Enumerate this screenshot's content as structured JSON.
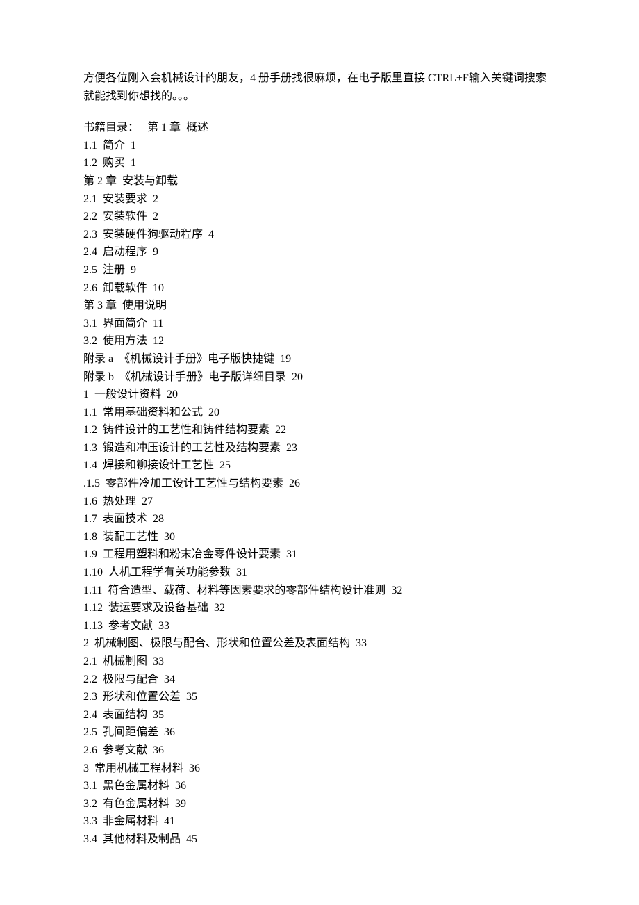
{
  "intro": "方便各位刚入会机械设计的朋友，4 册手册找很麻烦，在电子版里直接 CTRL+F输入关键词搜索就能找到你想找的。。。",
  "toc_prefix": "书籍目录：   ",
  "lines": [
    "第 1 章  概述",
    "1.1  简介  1",
    "1.2  购买  1",
    "第 2 章  安装与卸载",
    "2.1  安装要求  2",
    "2.2  安装软件  2",
    "2.3  安装硬件狗驱动程序  4",
    "2.4  启动程序  9",
    "2.5  注册  9",
    "2.6  卸载软件  10",
    "第 3 章  使用说明",
    "3.1  界面简介  11",
    "3.2  使用方法  12",
    "附录 a  《机械设计手册》电子版快捷键  19",
    "附录 b  《机械设计手册》电子版详细目录  20",
    "1  一般设计资料  20",
    "1.1  常用基础资料和公式  20",
    "1.2  铸件设计的工艺性和铸件结构要素  22",
    "1.3  锻造和冲压设计的工艺性及结构要素  23",
    "1.4  焊接和铆接设计工艺性  25",
    ".1.5  零部件冷加工设计工艺性与结构要素  26",
    "1.6  热处理  27",
    "1.7  表面技术  28",
    "1.8  装配工艺性  30",
    "1.9  工程用塑料和粉末冶金零件设计要素  31",
    "1.10  人机工程学有关功能参数  31",
    "1.11  符合造型、载荷、材料等因素要求的零部件结构设计准则  32",
    "1.12  装运要求及设备基础  32",
    "1.13  参考文献  33",
    "2  机械制图、极限与配合、形状和位置公差及表面结构  33",
    "2.1  机械制图  33",
    "2.2  极限与配合  34",
    "2.3  形状和位置公差  35",
    "2.4  表面结构  35",
    "2.5  孔间距偏差  36",
    "2.6  参考文献  36",
    "3  常用机械工程材料  36",
    "3.1  黑色金属材料  36",
    "3.2  有色金属材料  39",
    "3.3  非金属材料  41",
    "3.4  其他材料及制品  45"
  ]
}
